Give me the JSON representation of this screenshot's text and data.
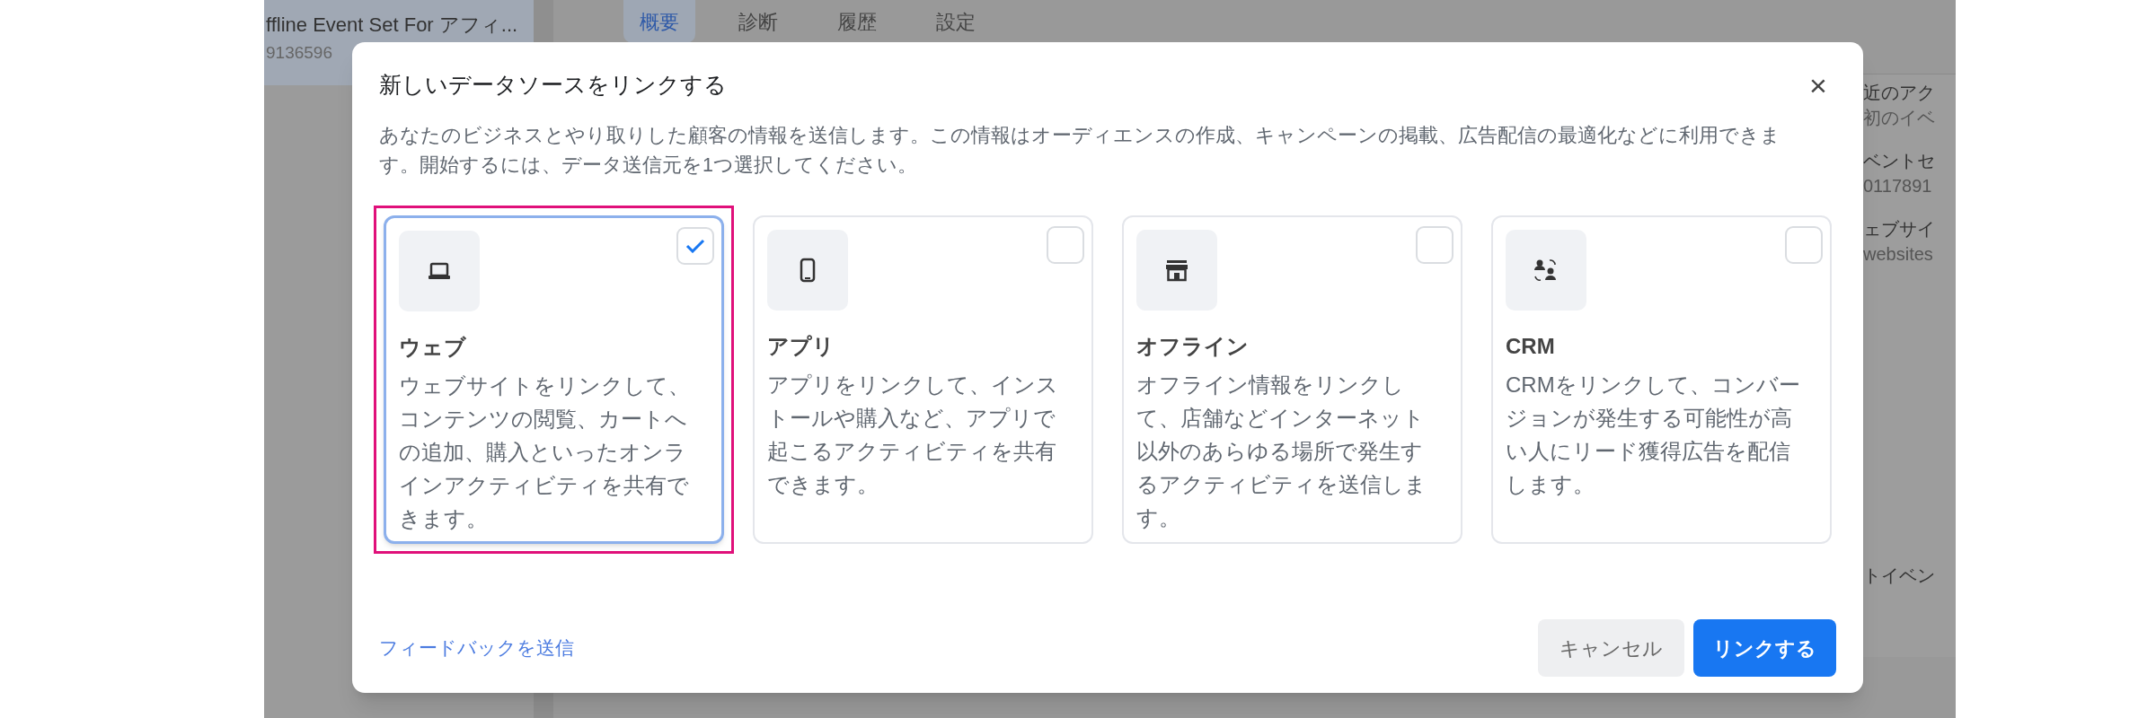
{
  "backdrop": {
    "list_item": {
      "title": "ffline Event Set For アフィ...",
      "id": "9136596",
      "selected": true
    },
    "tabs": [
      {
        "label": "概要",
        "selected": true
      },
      {
        "label": "診断",
        "selected": false
      },
      {
        "label": "履歴",
        "selected": false
      },
      {
        "label": "設定",
        "selected": false
      }
    ],
    "side_texts": [
      "近のアク",
      "初のイベ",
      "ベントセ",
      "0117891",
      "ェブサイ",
      "websites",
      "トイベン"
    ]
  },
  "dialog": {
    "title": "新しいデータソースをリンクする",
    "close": "×",
    "description": "あなたのビジネスとやり取りした顧客の情報を送信します。この情報はオーディエンスの作成、キャンペーンの掲載、広告配信の最適化などに利用できます。開始するには、データ送信元を1つ選択してください。",
    "options": [
      {
        "title": "ウェブ",
        "description": "ウェブサイトをリンクして、コンテンツの閲覧、カートへの追加、購入といったオンラインアクティビティを共有できます。",
        "checked": true,
        "highlighted": true
      },
      {
        "title": "アプリ",
        "description": "アプリをリンクして、インストールや購入など、アプリで起こるアクティビティを共有できます。",
        "checked": false,
        "highlighted": false
      },
      {
        "title": "オフライン",
        "description": "オフライン情報をリンクして、店舗などインターネット以外のあらゆる場所で発生するアクティビティを送信します。",
        "checked": false,
        "highlighted": false
      },
      {
        "title": "CRM",
        "description": "CRMをリンクして、コンバージョンが発生する可能性が高い人にリード獲得広告を配信します。",
        "checked": false,
        "highlighted": false
      }
    ],
    "feedback_link": "フィードバックを送信",
    "buttons": [
      {
        "label": "キャンセル",
        "kind": "secondary"
      },
      {
        "label": "リンクする",
        "kind": "primary"
      }
    ]
  }
}
